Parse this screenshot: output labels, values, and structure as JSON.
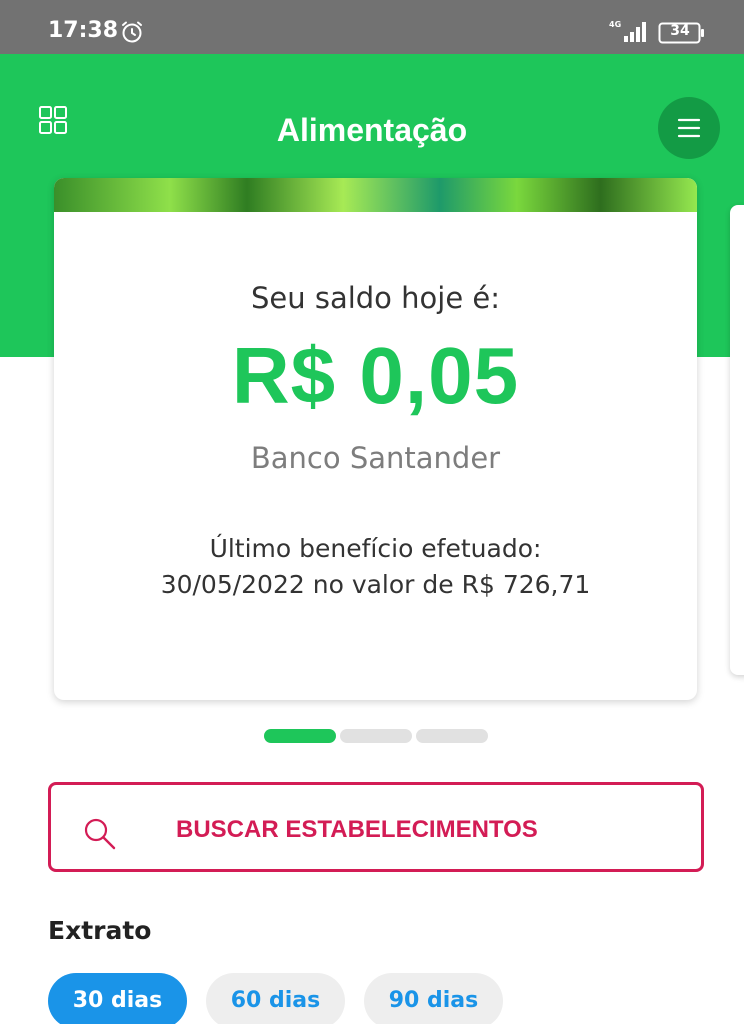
{
  "status_bar": {
    "time": "17:38",
    "network": "4G",
    "battery": "34",
    "icons": [
      "alarm-icon",
      "signal-icon",
      "battery-icon"
    ]
  },
  "header": {
    "title": "Alimentação",
    "left_icon": "grid-icon",
    "right_icon": "menu-icon"
  },
  "card": {
    "balance_label": "Seu saldo hoje é:",
    "balance_value": "R$ 0,05",
    "bank": "Banco Santander",
    "benefit_line1": "Último benefício efetuado:",
    "benefit_line2": "30/05/2022 no valor de R$ 726,71"
  },
  "pager": {
    "pages": 3,
    "active": 1
  },
  "search": {
    "label": "BUSCAR ESTABELECIMENTOS",
    "icon": "search-icon"
  },
  "statement": {
    "title": "Extrato",
    "filters": [
      {
        "label": "30 dias",
        "selected": true
      },
      {
        "label": "60 dias",
        "selected": false
      },
      {
        "label": "90 dias",
        "selected": false
      }
    ]
  },
  "colors": {
    "brand_green": "#1ec65a",
    "dark_green": "#139b45",
    "accent_red": "#d31c55",
    "accent_blue": "#1a94e8",
    "status_gray": "#727272"
  }
}
